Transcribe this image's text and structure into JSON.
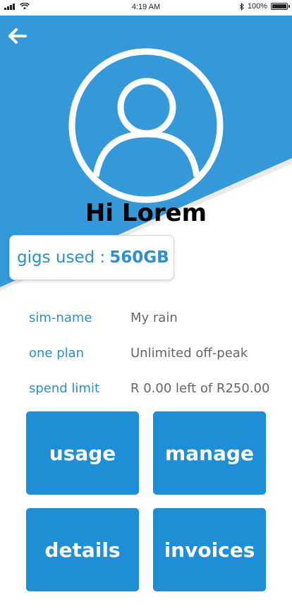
{
  "status_bar": {
    "time": "4:19 AM",
    "battery": "100%",
    "bluetooth_icon": "bluetooth-icon",
    "signal_icon": "cellular-signal-icon",
    "wifi_icon": "wifi-icon",
    "battery_icon": "battery-icon"
  },
  "header": {
    "back_icon": "arrow-left-icon",
    "avatar_icon": "user-avatar-icon",
    "greeting": "Hi Lorem",
    "accent_color": "#3399d9"
  },
  "usage_card": {
    "label": "gigs used :",
    "value": "560GB"
  },
  "account": {
    "rows": [
      {
        "label": "sim-name",
        "value": "My rain"
      },
      {
        "label": "one plan",
        "value": "Unlimited off-peak"
      },
      {
        "label": "spend limit",
        "value": "R 0.00 left of R250.00"
      }
    ]
  },
  "actions": {
    "tiles": [
      {
        "label": "usage"
      },
      {
        "label": "manage"
      },
      {
        "label": "details"
      },
      {
        "label": "invoices"
      }
    ],
    "tile_color": "#1e8fd6"
  }
}
